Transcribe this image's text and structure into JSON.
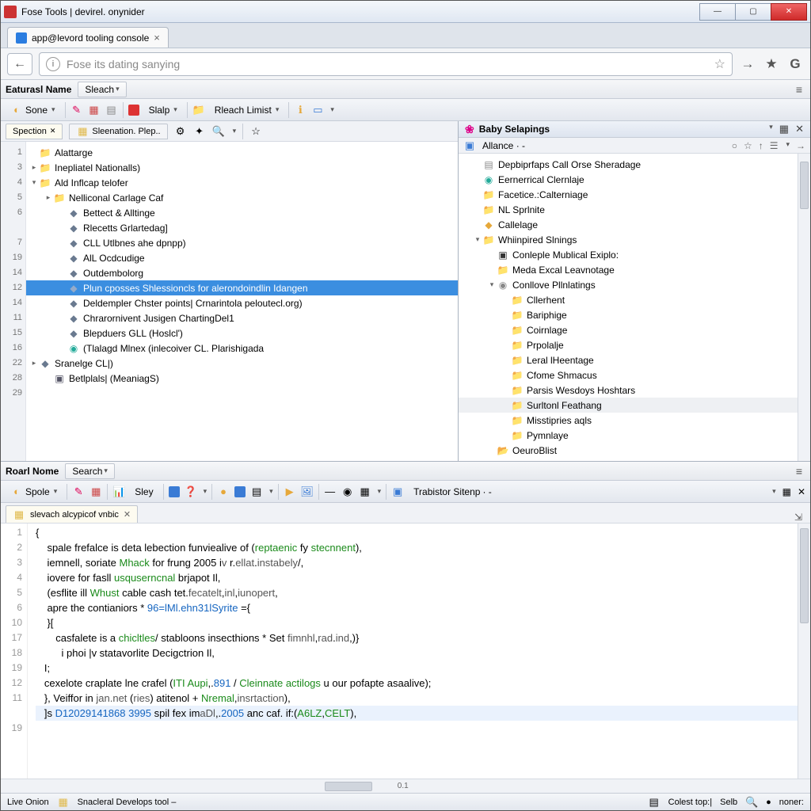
{
  "window": {
    "title": "Fose Tools | devirel. onynider"
  },
  "browser_tab": {
    "label": "app@levord tooling console"
  },
  "url_placeholder": "Fose its dating sanying",
  "header1": {
    "label": "Eaturasl Name",
    "search": "Sleach"
  },
  "toolbar1": {
    "menu": "Sone",
    "btn": "Slalp",
    "btn2": "Rleach Limist"
  },
  "left_pane": {
    "title": "Baby Selapings",
    "tab": "Spection",
    "tab2": "Sleenation. Plep..",
    "gutter": [
      "1",
      "3",
      "4",
      "5",
      "6",
      "",
      "7",
      "19",
      "14",
      "12",
      "14",
      "11",
      "15",
      "16",
      "22",
      "28",
      "29"
    ],
    "tree": [
      {
        "d": 0,
        "exp": "",
        "ico": "fold",
        "t": "Alattarge"
      },
      {
        "d": 0,
        "exp": "▸",
        "ico": "fold",
        "t": "Inepliatel Nationalls)"
      },
      {
        "d": 0,
        "exp": "▾",
        "ico": "fold",
        "t": "Ald Inflcap telofer"
      },
      {
        "d": 1,
        "exp": "▸",
        "ico": "fold",
        "t": "Nelliconal Carlage Caf"
      },
      {
        "d": 2,
        "exp": "",
        "ico": "file",
        "t": "Bettect & Alltinge"
      },
      {
        "d": 2,
        "exp": "",
        "ico": "file",
        "t": "Rlecetts Grlartedag]"
      },
      {
        "d": 2,
        "exp": "",
        "ico": "file",
        "t": "CLL Utlbnes ahe dpnpp)"
      },
      {
        "d": 2,
        "exp": "",
        "ico": "file",
        "t": "AlL Ocdcudige"
      },
      {
        "d": 2,
        "exp": "",
        "ico": "file",
        "t": "Outdembolorg"
      },
      {
        "d": 2,
        "exp": "",
        "ico": "file",
        "t": "Plun cposses Shlessioncls for alerondoindlin Idangen",
        "sel": true
      },
      {
        "d": 2,
        "exp": "",
        "ico": "file",
        "t": "Deldempler Chster points| Crnarintola peloutecl.org)"
      },
      {
        "d": 2,
        "exp": "",
        "ico": "file",
        "t": "Chrarornivent Jusigen ChartingDel1"
      },
      {
        "d": 2,
        "exp": "",
        "ico": "file",
        "t": "Blepduers GLL (Hoslcl')"
      },
      {
        "d": 2,
        "exp": "",
        "ico": "grn",
        "t": "(Tlalagd Mlnex (inlecoiver CL. Plarishigada"
      },
      {
        "d": 0,
        "exp": "▸",
        "ico": "file",
        "t": "Sranelge CL|)"
      },
      {
        "d": 1,
        "exp": "",
        "ico": "img",
        "t": "Betlplals| (MeaniagS)"
      }
    ]
  },
  "right_pane": {
    "crumb": "Allance · -",
    "tree": [
      {
        "d": 0,
        "exp": "",
        "ico": "doc",
        "t": "Depbiprfaps Call Orse Sheradage"
      },
      {
        "d": 0,
        "exp": "",
        "ico": "grn",
        "t": "Eernerrical Clernlaje"
      },
      {
        "d": 0,
        "exp": "",
        "ico": "pfold",
        "t": "Facetice.:Calterniage"
      },
      {
        "d": 0,
        "exp": "",
        "ico": "pfold",
        "t": "NL Sprlnite"
      },
      {
        "d": 0,
        "exp": "",
        "ico": "yel",
        "t": "Callelage"
      },
      {
        "d": 0,
        "exp": "▾",
        "ico": "pfold",
        "t": "Whiinpired Slnings"
      },
      {
        "d": 1,
        "exp": "",
        "ico": "blk",
        "t": "Conleple Mublical Exiplo:"
      },
      {
        "d": 1,
        "exp": "",
        "ico": "pfold",
        "t": "Meda Excal Leavnotage"
      },
      {
        "d": 1,
        "exp": "▾",
        "ico": "gry",
        "t": "Conllove Pllnlatings"
      },
      {
        "d": 2,
        "exp": "",
        "ico": "pfold",
        "t": "Cllerhent"
      },
      {
        "d": 2,
        "exp": "",
        "ico": "pfold",
        "t": "Bariphige"
      },
      {
        "d": 2,
        "exp": "",
        "ico": "pfold",
        "t": "Coirnlage"
      },
      {
        "d": 2,
        "exp": "",
        "ico": "pfold",
        "t": "Prpolalje"
      },
      {
        "d": 2,
        "exp": "",
        "ico": "pfold",
        "t": "Leral lHeentage"
      },
      {
        "d": 2,
        "exp": "",
        "ico": "pfold",
        "t": "Cfome Shmacus"
      },
      {
        "d": 2,
        "exp": "",
        "ico": "pfold",
        "t": "Parsis Wesdoys Hoshtars"
      },
      {
        "d": 2,
        "exp": "",
        "ico": "pfold",
        "t": "Surltonl Feathang",
        "hl": true
      },
      {
        "d": 2,
        "exp": "",
        "ico": "pfold",
        "t": "Misstipries aqls"
      },
      {
        "d": 2,
        "exp": "",
        "ico": "pfold",
        "t": "Pymnlaye"
      },
      {
        "d": 1,
        "exp": "",
        "ico": "yfold",
        "t": "OeuroBlist"
      }
    ]
  },
  "header2": {
    "label": "Roarl Nome",
    "search": "Search"
  },
  "toolbar2": {
    "menu": "Spole",
    "btn": "Sley",
    "btn2": "Trabistor Sitenp"
  },
  "code_tab": "slevach alcypicof vnbic",
  "code": {
    "gutter": [
      "1",
      "2",
      "3",
      "4",
      "5",
      "6",
      "10",
      "17",
      "18",
      "19",
      "12",
      "11",
      "",
      "19"
    ],
    "lines": [
      "{",
      "    spale frefalce is deta lebection funviealive of (<span class='kw'>reptaenic</span> fy <span class='kw'>stecnnent</span>),",
      "    iemnell, soriate <span class='kw'>Mhack</span> for frung 2005 i<span class='fn'>v</span> r.<span class='fn'>ellat</span>.<span class='fn'>instabely</span>/,",
      "    iovere for fasll <span class='kw'>usquserncnal</span> brjapot Il,",
      "    (esflite ill <span class='kw'>Whust</span> cable cash tet.<span class='fn'>fecatelt</span>,<span class='fn'>inl</span>,<span class='fn'>iunopert</span>,",
      "    apre the contianiors * <span class='num'>96=lMl.ehn31lSyrite</span> ={",
      "    }[",
      "       casfalete is a <span class='kw'>chicltles</span>/ stabloons insecthions * Set <span class='fn'>fimnhl</span>,<span class='fn'>rad</span>.<span class='fn'>ind</span>,)}",
      "         i phoi |v statavorlite Decigctrion Il,",
      "   I;",
      "   cexelote craplate lne crafel (<span class='kw'>ITI Aupi</span>,.<span class='num'>891</span> / <span class='kw'>Cleinnate actilogs</span> u our pofapte asaalive);",
      "   }, Veiffor in <span class='fn'>jan.net</span> (<span class='fn'>ries</span>) atitenol + <span class='kw'>Nremal</span>,<span class='fn'>insrtaction</span>),",
      "<span class='hl-line'>   ]s <span class='num'>D12029141868 3995</span> spil fex im<span class='fn'>aDl</span>,.<span class='num'>2005</span> anc caf. if:(<span class='kw'>A6LZ</span>,<span class='kw'>CELT</span>),</span>"
    ]
  },
  "hscroll_val": "0.1",
  "status": {
    "left1": "Live Onion",
    "left2": "Snacleral Develops tool –",
    "r1": "Colest top:|",
    "r2": "Selb",
    "r3": "noner:"
  }
}
